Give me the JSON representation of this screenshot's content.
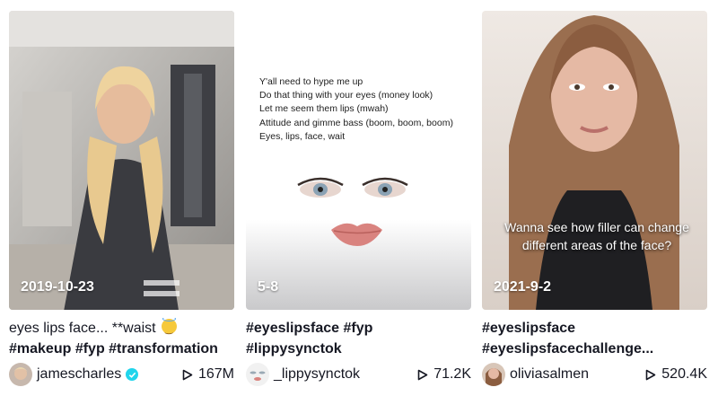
{
  "cards": [
    {
      "badge": "2019-10-23",
      "desc_line1_text": "eyes lips face... **waist",
      "desc_line1_emoji": "smiling-face-with-halo",
      "desc_line2": "#makeup #fyp #transformation",
      "username": "jamescharles",
      "verified": true,
      "views": "167M"
    },
    {
      "badge": "5-8",
      "lyrics": [
        "Y'all need to hype me up",
        "Do that thing with your eyes (money look)",
        "Let me seem them lips (mwah)",
        "Attitude and gimme bass (boom, boom, boom)",
        "Eyes, lips, face, wait"
      ],
      "desc_line1": "#eyeslipsface #fyp",
      "desc_line2": "#lippysynctok",
      "username": "_lippysynctok",
      "verified": false,
      "views": "71.2K"
    },
    {
      "badge": "2021-9-2",
      "overlay_caption": "Wanna see how filler can change different areas of the face?",
      "desc_line1": "#eyeslipsface",
      "desc_line2": "#eyeslipsfacechallenge...",
      "username": "oliviasalmen",
      "verified": false,
      "views": "520.4K"
    }
  ],
  "icons": {
    "play": "play-icon",
    "verified": "verified-check-icon"
  },
  "colors": {
    "text": "#161823",
    "verified": "#20d5ec"
  }
}
